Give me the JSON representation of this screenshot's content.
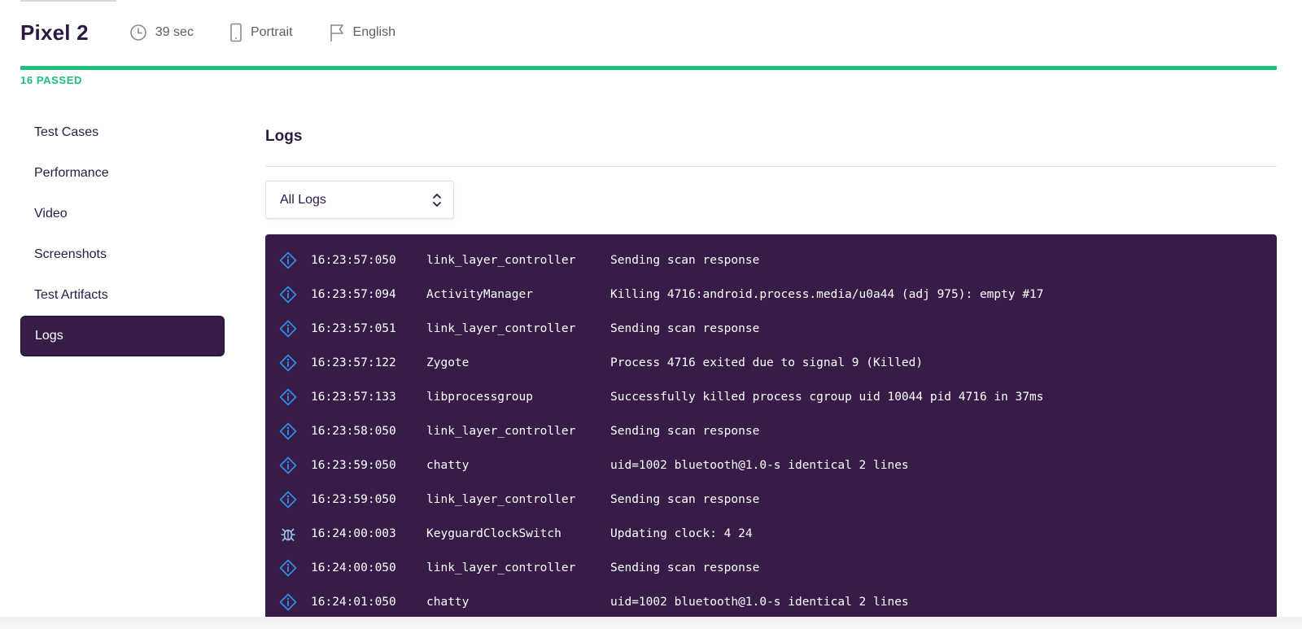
{
  "header": {
    "device": "Pixel 2",
    "duration": "39 sec",
    "orientation": "Portrait",
    "locale": "English"
  },
  "status": {
    "passed_label": "16 PASSED",
    "progress_fraction": 1.0,
    "color": "#1fbf7a"
  },
  "sidebar": {
    "items": [
      {
        "label": "Test Cases",
        "active": false
      },
      {
        "label": "Performance",
        "active": false
      },
      {
        "label": "Video",
        "active": false
      },
      {
        "label": "Screenshots",
        "active": false
      },
      {
        "label": "Test Artifacts",
        "active": false
      },
      {
        "label": "Logs",
        "active": true
      }
    ]
  },
  "main": {
    "title": "Logs",
    "filter": {
      "selected": "All Logs"
    },
    "logs": [
      {
        "level": "info-icon",
        "time": "16:23:57:050",
        "tag": "link_layer_controller",
        "message": "Sending scan response"
      },
      {
        "level": "info-icon",
        "time": "16:23:57:094",
        "tag": "ActivityManager",
        "message": "Killing 4716:android.process.media/u0a44 (adj 975): empty #17"
      },
      {
        "level": "info-icon",
        "time": "16:23:57:051",
        "tag": "link_layer_controller",
        "message": "Sending scan response"
      },
      {
        "level": "info-icon",
        "time": "16:23:57:122",
        "tag": "Zygote",
        "message": "Process 4716 exited due to signal 9 (Killed)"
      },
      {
        "level": "info-icon",
        "time": "16:23:57:133",
        "tag": "libprocessgroup",
        "message": "Successfully killed process cgroup uid 10044 pid 4716 in 37ms"
      },
      {
        "level": "info-icon",
        "time": "16:23:58:050",
        "tag": "link_layer_controller",
        "message": "Sending scan response"
      },
      {
        "level": "info-icon",
        "time": "16:23:59:050",
        "tag": "chatty",
        "message": "uid=1002 bluetooth@1.0-s identical 2 lines"
      },
      {
        "level": "info-icon",
        "time": "16:23:59:050",
        "tag": "link_layer_controller",
        "message": "Sending scan response"
      },
      {
        "level": "bug-icon",
        "time": "16:24:00:003",
        "tag": "KeyguardClockSwitch",
        "message": "Updating clock: 4 24"
      },
      {
        "level": "info-icon",
        "time": "16:24:00:050",
        "tag": "link_layer_controller",
        "message": "Sending scan response"
      },
      {
        "level": "info-icon",
        "time": "16:24:01:050",
        "tag": "chatty",
        "message": "uid=1002 bluetooth@1.0-s identical 2 lines"
      },
      {
        "level": "info-icon",
        "time": "",
        "tag": "",
        "message": ""
      }
    ]
  },
  "colors": {
    "brand": "#361c47",
    "success": "#1fbf7a",
    "info": "#2f8fe8",
    "debug": "#9ec3ef"
  }
}
